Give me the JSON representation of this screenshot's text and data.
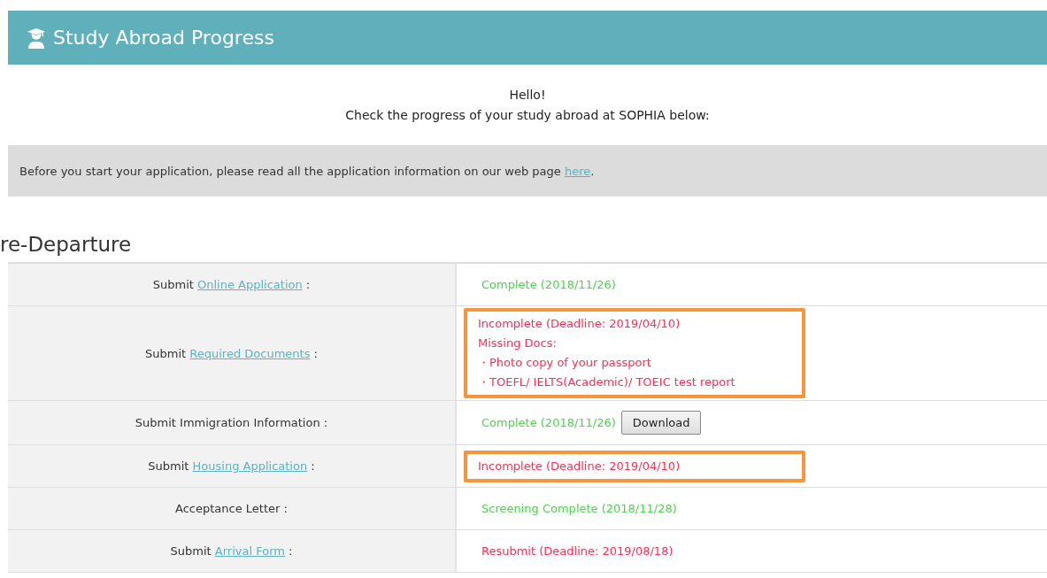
{
  "header": {
    "title": "Study Abroad Progress"
  },
  "greeting": [
    "Hello!",
    "Check the progress of your study abroad at SOPHIA below:"
  ],
  "notice": {
    "text": "Before you start your application, please read all the application information on our web page ",
    "link": "here",
    "after": "."
  },
  "section": {
    "title": "re-Departure"
  },
  "rows": [
    {
      "prefix": "Submit",
      "link": "Online Application",
      "suffix": ":",
      "color": "#4fd24f",
      "highlighted": false,
      "lines": [
        "Complete (2018/11/26)"
      ]
    },
    {
      "prefix": "Submit",
      "link": "Required Documents",
      "suffix": ":",
      "color": "#ff2d55",
      "highlighted": true,
      "lines": [
        "Incomplete (Deadline: 2019/04/10)",
        "Missing Docs:",
        "・Photo copy of your passport",
        "・TOEFL/ IELTS(Academic)/ TOEIC test report"
      ]
    },
    {
      "prefix": "Submit Immigration Information",
      "suffix": ":",
      "color": "#4fd24f",
      "highlighted": false,
      "lines": [
        "Complete (2018/11/26)"
      ],
      "button": "Download"
    },
    {
      "prefix": "Submit",
      "link": "Housing Application",
      "suffix": ":",
      "color": "#ff2d55",
      "highlighted": true,
      "lines": [
        "Incomplete (Deadline: 2019/04/10)"
      ]
    },
    {
      "prefix": "Acceptance Letter",
      "suffix": ":",
      "color": "#4fd24f",
      "highlighted": false,
      "lines": [
        "Screening Complete (2018/11/28)"
      ]
    },
    {
      "prefix": "Submit",
      "link": "Arrival Form",
      "suffix": ":",
      "color": "#ff2d55",
      "highlighted": false,
      "lines": [
        "Resubmit (Deadline: 2019/08/18)"
      ]
    }
  ]
}
